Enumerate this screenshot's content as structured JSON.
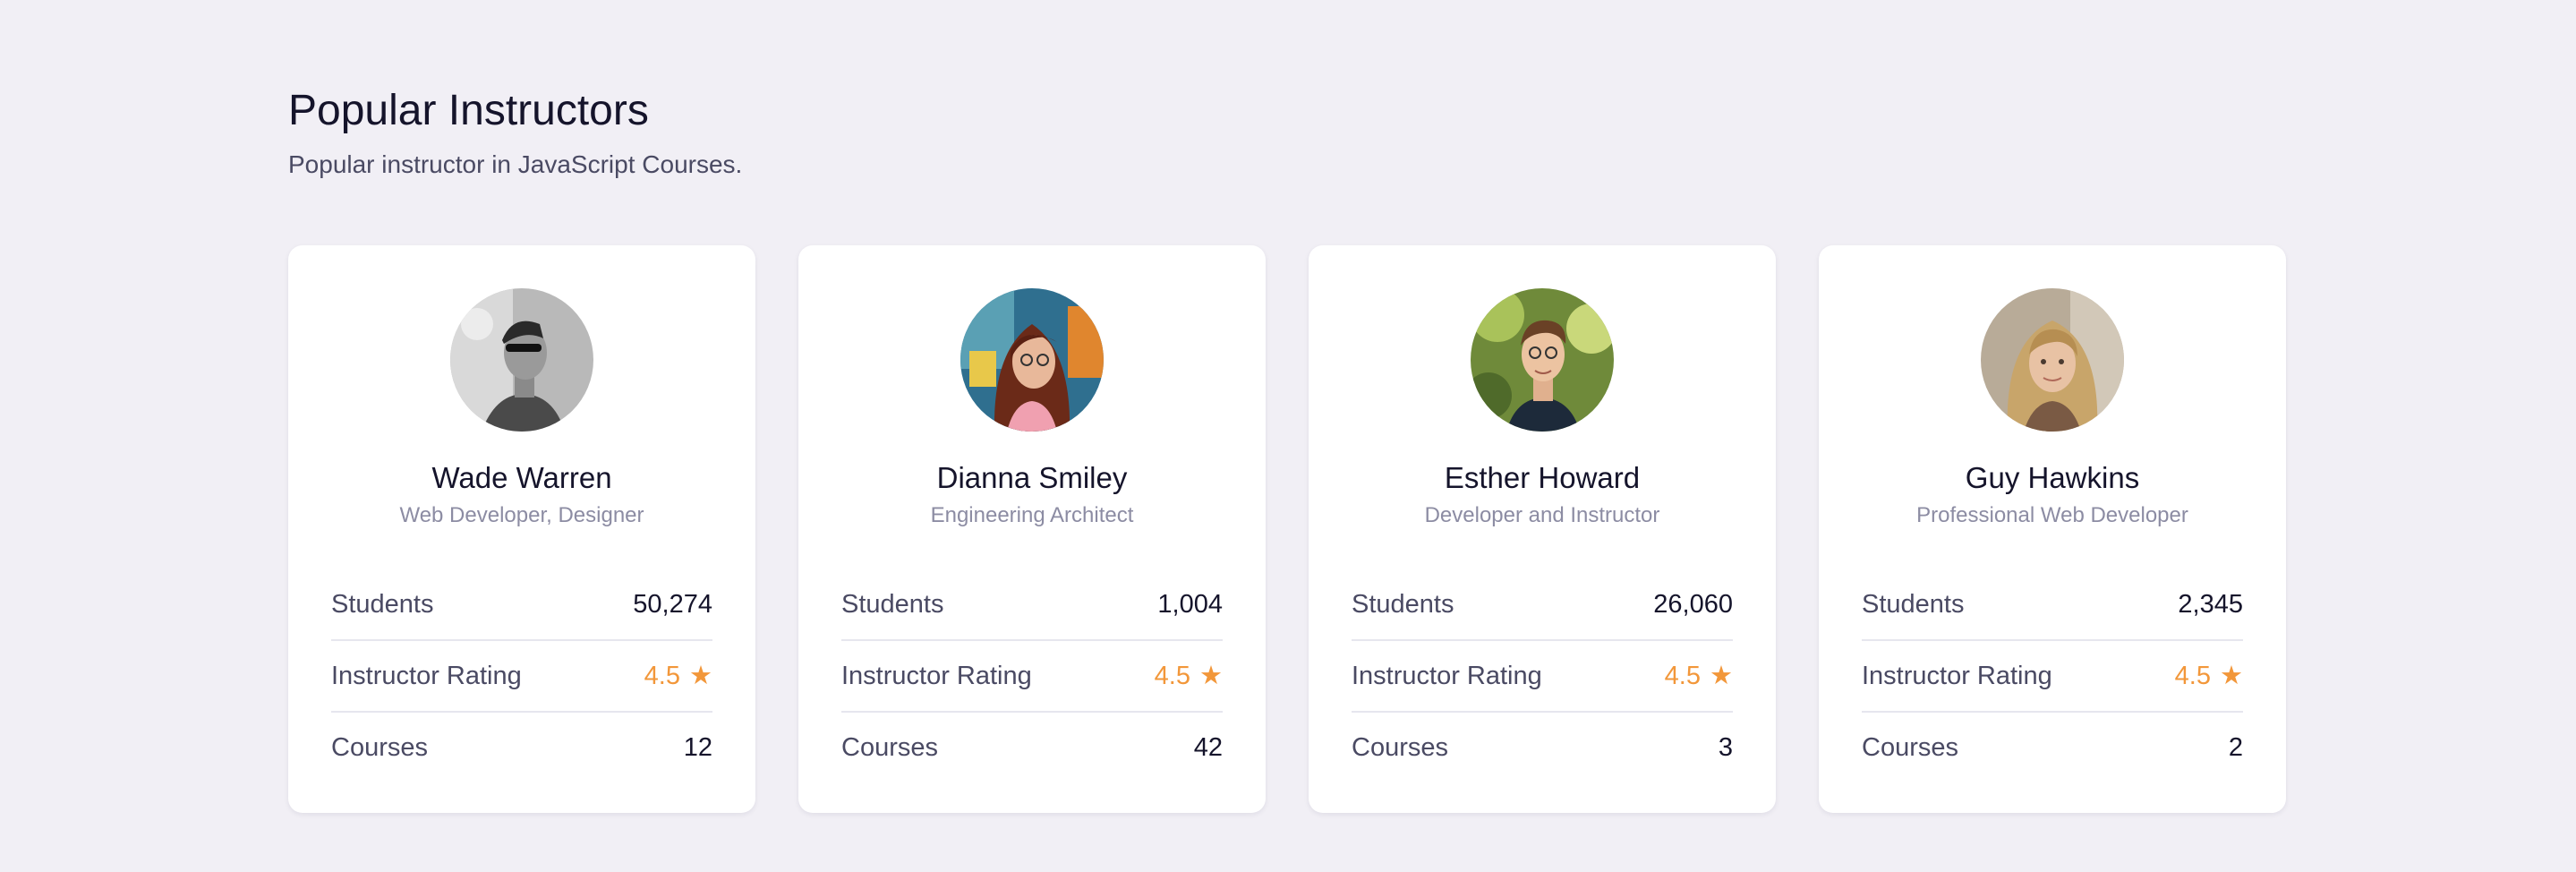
{
  "section": {
    "title": "Popular Instructors",
    "subtitle": "Popular instructor in JavaScript Courses."
  },
  "labels": {
    "students": "Students",
    "rating": "Instructor Rating",
    "courses": "Courses"
  },
  "colors": {
    "accent": "#f2973a",
    "background": "#f1eff5",
    "card": "#ffffff"
  },
  "instructors": [
    {
      "name": "Wade Warren",
      "role": "Web Developer, Designer",
      "students": "50,274",
      "rating": "4.5",
      "courses": "12"
    },
    {
      "name": "Dianna Smiley",
      "role": "Engineering Architect",
      "students": "1,004",
      "rating": "4.5",
      "courses": "42"
    },
    {
      "name": "Esther Howard",
      "role": "Developer and Instructor",
      "students": "26,060",
      "rating": "4.5",
      "courses": "3"
    },
    {
      "name": "Guy Hawkins",
      "role": "Professional Web Developer",
      "students": "2,345",
      "rating": "4.5",
      "courses": "2"
    }
  ]
}
